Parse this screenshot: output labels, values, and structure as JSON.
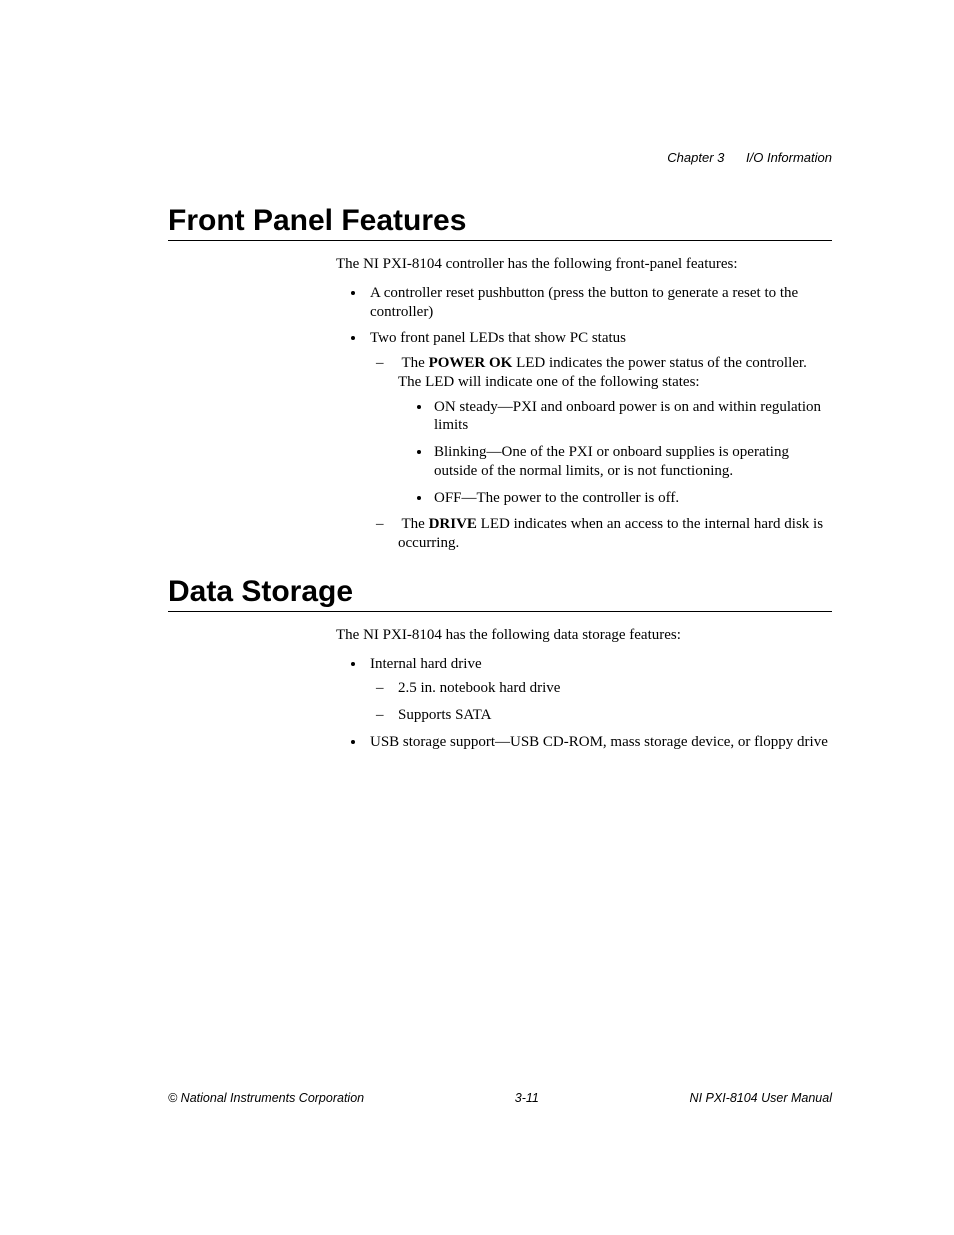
{
  "header": {
    "chapter": "Chapter 3",
    "title": "I/O Information"
  },
  "sections": {
    "front_panel": {
      "title": "Front Panel Features",
      "intro": "The NI PXI-8104 controller has the following front-panel features:",
      "items": {
        "reset": "A controller reset pushbutton (press the button to generate a reset to the controller)",
        "leds_intro": "Two front panel LEDs that show PC status",
        "power_ok_pre": "The ",
        "power_ok_bold": "POWER OK",
        "power_ok_post": " LED indicates the power status of the controller. The LED will indicate one of the following states:",
        "states": {
          "on": "ON steady—PXI and onboard power is on and within regulation limits",
          "blink": "Blinking—One of the PXI or onboard supplies is operating outside of the normal limits, or is not functioning.",
          "off": "OFF—The power to the controller is off."
        },
        "drive_pre": "The ",
        "drive_bold": "DRIVE",
        "drive_post": " LED indicates when an access to the internal hard disk is occurring."
      }
    },
    "data_storage": {
      "title": "Data Storage",
      "intro": "The NI PXI-8104 has the following data storage features:",
      "items": {
        "internal": "Internal hard drive",
        "sub": {
          "size": "2.5 in. notebook hard drive",
          "sata": "Supports SATA"
        },
        "usb": "USB storage support—USB CD-ROM, mass storage device, or floppy drive"
      }
    }
  },
  "footer": {
    "left": "© National Instruments Corporation",
    "center": "3-11",
    "right": "NI PXI-8104 User Manual"
  }
}
